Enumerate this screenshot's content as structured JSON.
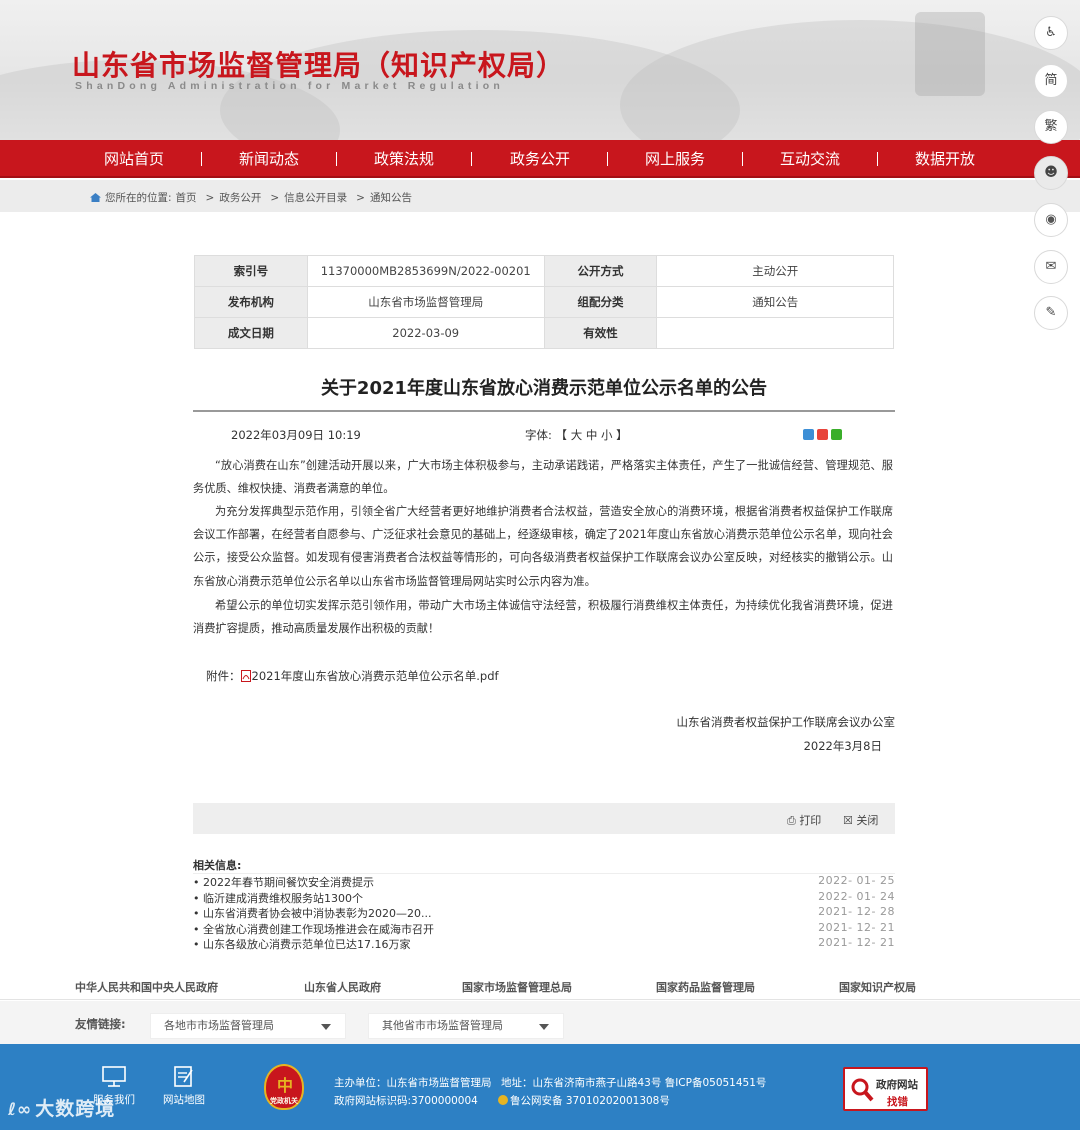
{
  "header": {
    "title": "山东省市场监督管理局（知识产权局）",
    "subtitle": "ShanDong Administration for Market Regulation"
  },
  "nav": [
    "网站首页",
    "新闻动态",
    "政策法规",
    "政务公开",
    "网上服务",
    "互动交流",
    "数据开放"
  ],
  "breadcrumb": {
    "prefix": "您所在的位置:",
    "items": [
      "首页",
      "政务公开",
      "信息公开目录",
      "通知公告"
    ],
    "separator": ">"
  },
  "meta": {
    "index_label": "索引号",
    "index_value": "11370000MB2853699N/2022-00201",
    "open_label": "公开方式",
    "open_value": "主动公开",
    "org_label": "发布机构",
    "org_value": "山东省市场监督管理局",
    "group_label": "组配分类",
    "group_value": "通知公告",
    "date_label": "成文日期",
    "date_value": "2022-03-09",
    "valid_label": "有效性",
    "valid_value": ""
  },
  "article": {
    "title": "关于2021年度山东省放心消费示范单位公示名单的公告",
    "publish_time": "2022年03月09日 10:19",
    "font_label": "字体: 【",
    "font_large": "大",
    "font_medium": "中",
    "font_small": "小",
    "font_end": "】",
    "paragraphs": [
      "“放心消费在山东”创建活动开展以来，广大市场主体积极参与，主动承诺践诺，严格落实主体责任，产生了一批诚信经营、管理规范、服务优质、维权快捷、消费者满意的单位。",
      "为充分发挥典型示范作用，引领全省广大经营者更好地维护消费者合法权益，营造安全放心的消费环境，根据省消费者权益保护工作联席会议工作部署，在经营者自愿参与、广泛征求社会意见的基础上，经逐级审核，确定了2021年度山东省放心消费示范单位公示名单，现向社会公示，接受公众监督。如发现有侵害消费者合法权益等情形的，可向各级消费者权益保护工作联席会议办公室反映，对经核实的撤销公示。山东省放心消费示范单位公示名单以山东省市场监督管理局网站实时公示内容为准。",
      "希望公示的单位切实发挥示范引领作用，带动广大市场主体诚信守法经营，积极履行消费维权主体责任，为持续优化我省消费环境，促进消费扩容提质，推动高质量发展作出积极的贡献！"
    ],
    "attachment_label": "附件：",
    "attachment_name": "2021年度山东省放心消费示范单位公示名单.pdf",
    "sign_org": "山东省消费者权益保护工作联席会议办公室",
    "sign_date": "2022年3月8日"
  },
  "tools": {
    "print": "打印",
    "close": "关闭"
  },
  "related": {
    "label": "相关信息:",
    "items": [
      {
        "title": "• 2022年春节期间餐饮安全消费提示",
        "date": "2022- 01- 25"
      },
      {
        "title": "• 临沂建成消费维权服务站1300个",
        "date": "2022- 01- 24"
      },
      {
        "title": "• 山东省消费者协会被中消协表彰为2020—20...",
        "date": "2021- 12- 28"
      },
      {
        "title": "• 全省放心消费创建工作现场推进会在威海市召开",
        "date": "2021- 12- 21"
      },
      {
        "title": "• 山东各级放心消费示范单位已达17.16万家",
        "date": "2021- 12- 21"
      }
    ]
  },
  "gov_links": [
    "中华人民共和国中央人民政府",
    "山东省人民政府",
    "国家市场监督管理总局",
    "国家药品监督管理局",
    "国家知识产权局"
  ],
  "friend_links": {
    "label": "友情链接:",
    "select1": "各地市市场监督管理局",
    "select2": "其他省市市场监督管理局"
  },
  "footer": {
    "icon1_label": "服务我们",
    "icon2_label": "网站地图",
    "emblem_text": "党政机关",
    "host": "主办单位：山东省市场监督管理局",
    "address": "地址：山东省济南市燕子山路43号 鲁ICP备05051451号",
    "site_code": "政府网站标识码:3700000004",
    "police": "鲁公网安备 37010202001308号",
    "find_error_1": "政府网站",
    "find_error_2": "找错"
  },
  "watermark": "大数跨境",
  "side_tools": [
    "accessibility-icon",
    "简",
    "繁",
    "robot-icon",
    "weibo-icon",
    "wechat-icon",
    "feedback-icon"
  ],
  "colors": {
    "brand_red": "#c8161d",
    "footer_blue": "#2d80c4"
  }
}
